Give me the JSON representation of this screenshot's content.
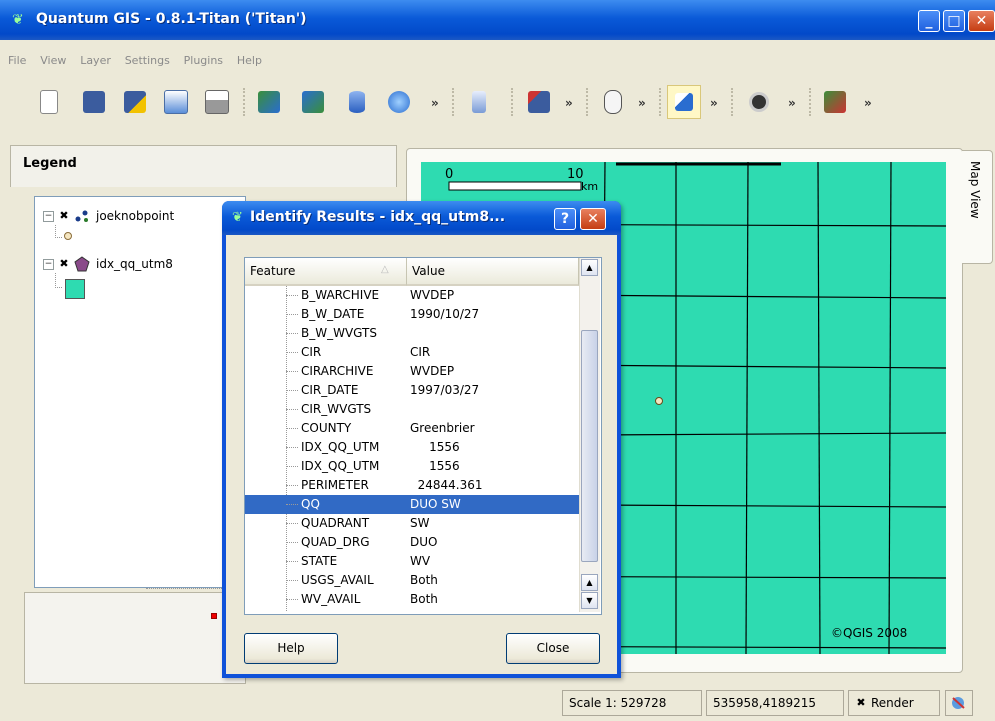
{
  "window": {
    "title": "Quantum GIS - 0.8.1-Titan ('Titan')",
    "controls": {
      "minimize": "_",
      "maximize": "□",
      "close": "✕"
    }
  },
  "menu": [
    "File",
    "View",
    "Layer",
    "Settings",
    "Plugins",
    "Help"
  ],
  "toolbar": {
    "more_glyph": "»",
    "buttons": [
      "new-project-icon",
      "save-icon",
      "save-as-icon",
      "open-icon",
      "print-icon",
      "add-raster-icon",
      "add-vector-icon",
      "add-postgis-icon",
      "add-wms-icon",
      "capture-icon",
      "edit-icon",
      "pan-icon",
      "identify-icon",
      "measure-icon",
      "plugin-icon"
    ]
  },
  "legend": {
    "title": "Legend",
    "layers": [
      {
        "name": "joeknobpoint"
      },
      {
        "name": "idx_qq_utm8",
        "swatch_color": "#2edbb1"
      }
    ],
    "expander": "−",
    "check": "✖"
  },
  "map": {
    "fill_color": "#2edbb1",
    "scale_bar": {
      "start": "0",
      "end": "10",
      "unit": "km"
    },
    "copyright": "©QGIS 2008",
    "tab_label": "Map View"
  },
  "status": {
    "scale": "Scale 1: 529728",
    "coords": "535958,4189215",
    "render_check": "✖",
    "render_label": "Render"
  },
  "dialog": {
    "title": "Identify Results - idx_qq_utm8...",
    "help_glyph": "?",
    "close_glyph": "✕",
    "columns": {
      "feature": "Feature",
      "value": "Value"
    },
    "rows": [
      {
        "feature": "B_WARCHIVE",
        "value": "WVDEP"
      },
      {
        "feature": "B_W_DATE",
        "value": "1990/10/27"
      },
      {
        "feature": "B_W_WVGTS",
        "value": ""
      },
      {
        "feature": "CIR",
        "value": "CIR"
      },
      {
        "feature": "CIRARCHIVE",
        "value": "WVDEP"
      },
      {
        "feature": "CIR_DATE",
        "value": "1997/03/27"
      },
      {
        "feature": "CIR_WVGTS",
        "value": ""
      },
      {
        "feature": "COUNTY",
        "value": "Greenbrier"
      },
      {
        "feature": "IDX_QQ_UTM",
        "value": "     1556"
      },
      {
        "feature": "IDX_QQ_UTM",
        "value": "     1556"
      },
      {
        "feature": "PERIMETER",
        "value": "  24844.361"
      },
      {
        "feature": "QQ",
        "value": "DUO SW",
        "selected": true
      },
      {
        "feature": "QUADRANT",
        "value": "SW"
      },
      {
        "feature": "QUAD_DRG",
        "value": "DUO"
      },
      {
        "feature": "STATE",
        "value": "WV"
      },
      {
        "feature": "USGS_AVAIL",
        "value": "Both"
      },
      {
        "feature": "WV_AVAIL",
        "value": "Both"
      }
    ],
    "help_label": "Help",
    "close_label": "Close"
  }
}
